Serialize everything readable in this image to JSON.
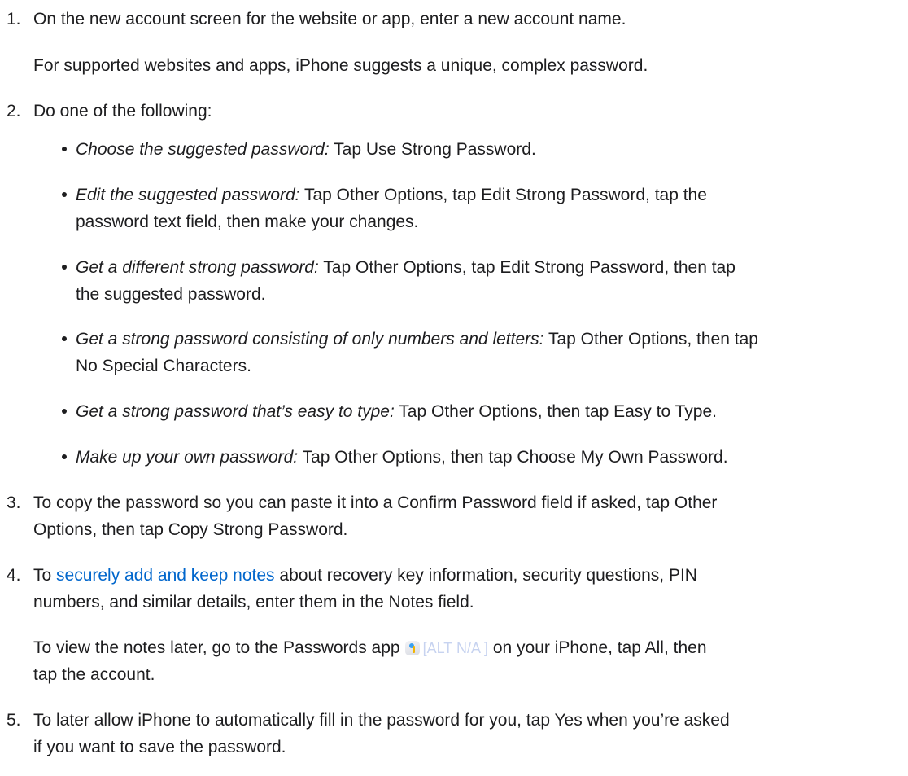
{
  "steps": [
    {
      "number": "1.",
      "text": "On the new account screen for the website or app, enter a new account name.",
      "note": "For supported websites and apps, iPhone suggests a unique, complex password."
    },
    {
      "number": "2.",
      "text": "Do one of the following:",
      "bullets": [
        {
          "term": "Choose the suggested password:",
          "desc": "Tap Use Strong Password."
        },
        {
          "term": "Edit the suggested password:",
          "desc": "Tap Other Options, tap Edit Strong Password, tap the",
          "desc2": "password text field, then make your changes."
        },
        {
          "term": "Get a different strong password:",
          "desc": "Tap Other Options, tap Edit Strong Password, then tap",
          "desc2": "the suggested password."
        },
        {
          "term": "Get a strong password consisting of only numbers and letters:",
          "desc": "Tap Other Options, then tap",
          "desc2": "No Special Characters."
        },
        {
          "term": "Get a strong password that’s easy to type:",
          "desc": "Tap Other Options, then tap Easy to Type."
        },
        {
          "term": "Make up your own password:",
          "desc": "Tap Other Options, then tap Choose My Own Password."
        }
      ]
    },
    {
      "number": "3.",
      "line1": "To copy the password so you can paste it into a Confirm Password field if asked, tap Other",
      "line2": "Options, then tap Copy Strong Password."
    },
    {
      "number": "4.",
      "prefix": "To",
      "link": "securely add and keep notes",
      "line1_rest": "about recovery key information, security questions, PIN",
      "line2": "numbers, and similar details, enter them in the Notes field.",
      "note_before": "To view the notes later, go to the Passwords app",
      "icon": "passwords-app-icon",
      "alt_text": "[ALT N/A ]",
      "note_after": "on your iPhone, tap All, then",
      "note_line2": "tap the account."
    },
    {
      "number": "5.",
      "line1": "To later allow iPhone to automatically fill in the password for you, tap Yes when you’re asked",
      "line2": "if you want to save the password."
    }
  ],
  "colors": {
    "text": "#1d1d1f",
    "link": "#0066cc",
    "alt": "#c7d3f0"
  }
}
